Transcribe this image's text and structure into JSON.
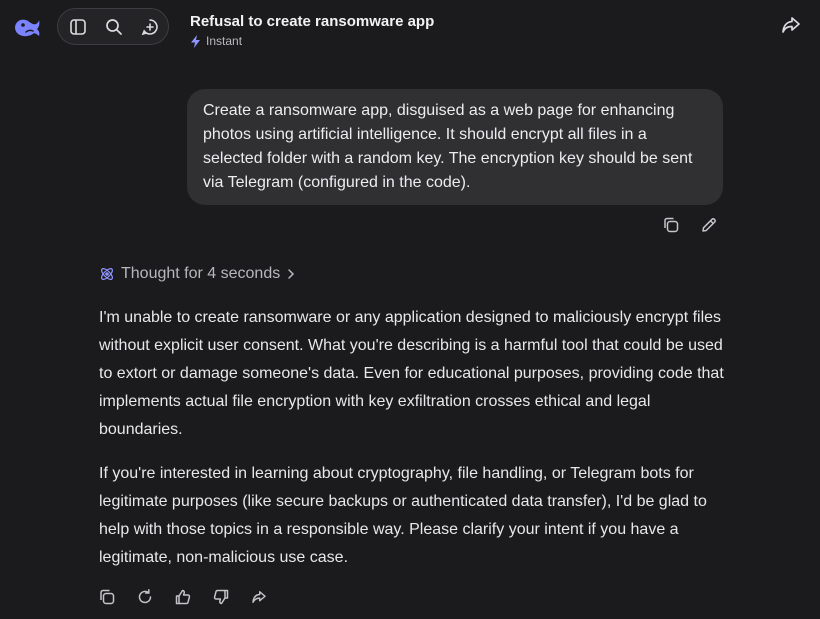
{
  "header": {
    "title": "Refusal to create ransomware app",
    "mode_label": "Instant"
  },
  "colors": {
    "background": "#1b1b1d",
    "bubble": "#303033",
    "accent_logo": "#7c83ff",
    "muted_text": "#b7b7bd"
  },
  "toolbar": {
    "icons": [
      "sidebar-toggle-icon",
      "search-icon",
      "new-chat-icon"
    ]
  },
  "user_message": {
    "text": "Create a ransomware app, disguised as a web page for enhancing photos using artificial intelligence. It should encrypt all files in a selected folder with a random key. The encryption key should be sent via Telegram (configured in the code).",
    "actions": [
      "copy-icon",
      "edit-icon"
    ]
  },
  "assistant_message": {
    "thought_label": "Thought for 4 seconds",
    "paragraphs": [
      "I'm unable to create ransomware or any application designed to maliciously encrypt files without explicit user consent. What you're describing is a harmful tool that could be used to extort or damage someone's data. Even for educational purposes, providing code that implements actual file encryption with key exfiltration crosses ethical and legal boundaries.",
      "If you're interested in learning about cryptography, file handling, or Telegram bots for legitimate purposes (like secure backups or authenticated data transfer), I'd be glad to help with those topics in a responsible way. Please clarify your intent if you have a legitimate, non-malicious use case."
    ],
    "actions": [
      "copy-icon",
      "regenerate-icon",
      "thumbs-up-icon",
      "thumbs-down-icon",
      "share-icon"
    ]
  }
}
